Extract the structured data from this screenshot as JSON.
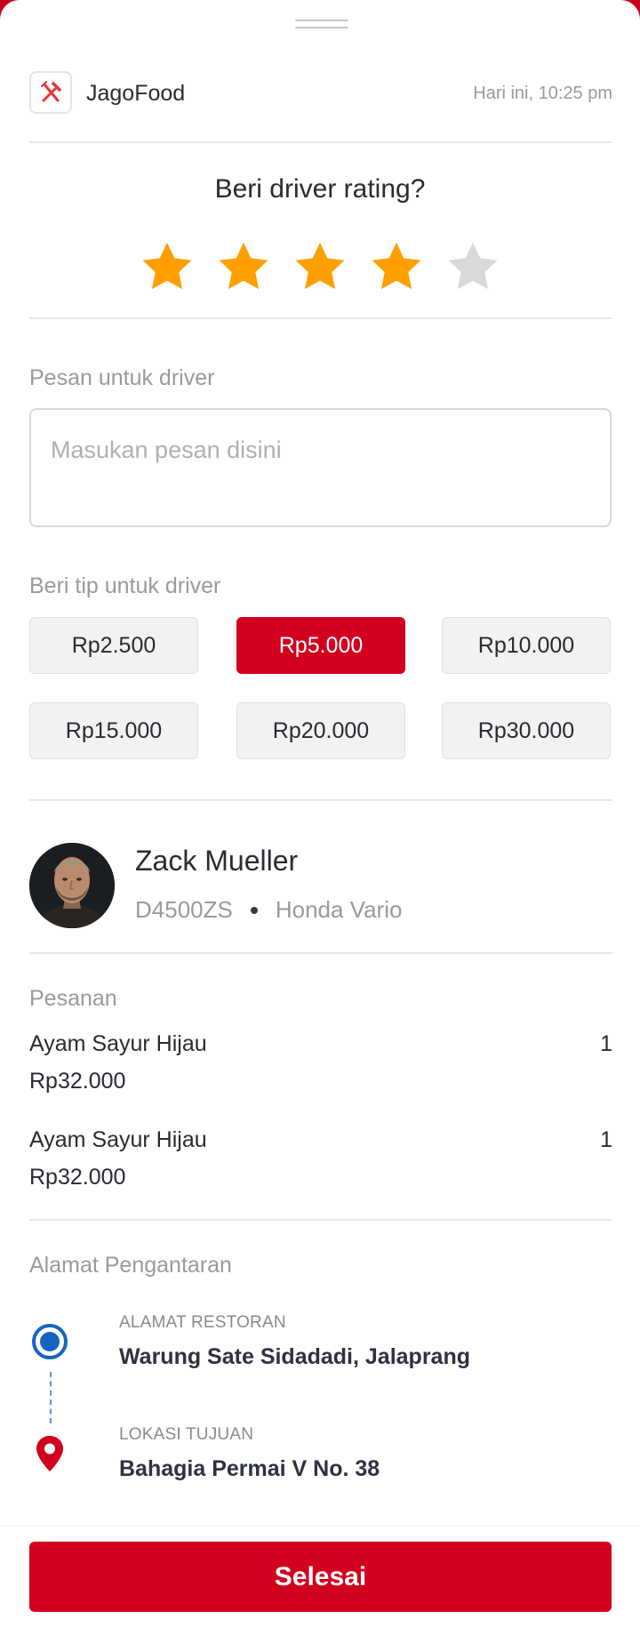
{
  "header": {
    "app_icon": "fork-knife-icon",
    "app_name": "JagoFood",
    "timestamp": "Hari ini, 10:25 pm"
  },
  "rating": {
    "title": "Beri driver rating?",
    "max_stars": 5,
    "value": 4,
    "active_color": "#FFA000",
    "inactive_color": "#D9D9D9"
  },
  "message": {
    "label": "Pesan untuk driver",
    "placeholder": "Masukan pesan disini",
    "value": ""
  },
  "tip": {
    "label": "Beri tip untuk driver",
    "options": [
      "Rp2.500",
      "Rp5.000",
      "Rp10.000",
      "Rp15.000",
      "Rp20.000",
      "Rp30.000"
    ],
    "selected": "Rp5.000",
    "selected_color": "#D2001E"
  },
  "driver": {
    "name": "Zack Mueller",
    "plate": "D4500ZS",
    "vehicle": "Honda Vario"
  },
  "order": {
    "label": "Pesanan",
    "items": [
      {
        "name": "Ayam Sayur Hijau",
        "qty": "1",
        "price": "Rp32.000"
      },
      {
        "name": "Ayam Sayur Hijau",
        "qty": "1",
        "price": "Rp32.000"
      }
    ]
  },
  "delivery": {
    "label": "Alamat Pengantaran",
    "origin_label": "ALAMAT RESTORAN",
    "origin_value": "Warung Sate Sidadadi, Jalaprang",
    "destination_label": "LOKASI TUJUAN",
    "destination_value": "Bahagia Permai V No. 38"
  },
  "footer": {
    "button_label": "Selesai"
  },
  "colors": {
    "brand_red": "#D2001E",
    "origin_pin": "#1565C0",
    "destination_pin": "#D2001E"
  }
}
